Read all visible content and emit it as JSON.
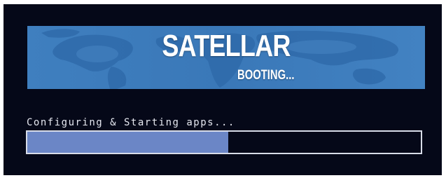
{
  "banner": {
    "title": "SATELLAR",
    "subtitle": "BOOTING..."
  },
  "status": {
    "message": "Configuring & Starting apps..."
  },
  "progress": {
    "value": 0.51
  },
  "colors": {
    "background": "#050818",
    "banner": "#3f7fbf",
    "progress_fill": "#6b86c6",
    "progress_border": "#d8dce8",
    "text": "#e6e8f0"
  }
}
